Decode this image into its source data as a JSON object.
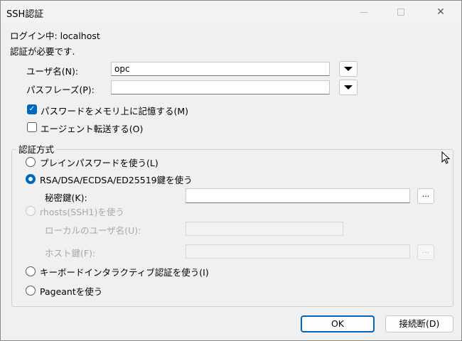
{
  "window": {
    "title": "SSH認証",
    "minimize_icon": "minimize-icon",
    "maximize_icon": "maximize-icon",
    "close_icon": "close-icon",
    "close_glyph": "✕"
  },
  "info": {
    "login_line": "ログイン中: localhost",
    "auth_required": "認証が必要です."
  },
  "form": {
    "username_label": "ユーザ名(N):",
    "username_value": "opc",
    "passphrase_label": "パスフレーズ(P):",
    "passphrase_value": "",
    "remember_password": {
      "label": "パスワードをメモリ上に記憶する(M)",
      "checked": true
    },
    "agent_forward": {
      "label": "エージェント転送する(O)",
      "checked": false
    }
  },
  "auth_method": {
    "group_label": "認証方式",
    "options": [
      {
        "label": "プレインパスワードを使う(L)",
        "selected": false,
        "enabled": true
      },
      {
        "label": "RSA/DSA/ECDSA/ED25519鍵を使う",
        "selected": true,
        "enabled": true
      },
      {
        "label": "rhosts(SSH1)を使う",
        "selected": false,
        "enabled": false
      },
      {
        "label": "キーボードインタラクティブ認証を使う(I)",
        "selected": false,
        "enabled": true
      },
      {
        "label": "Pageantを使う",
        "selected": false,
        "enabled": true
      }
    ],
    "private_key_label": "秘密鍵(K):",
    "private_key_value": "",
    "browse_label": "...",
    "local_user_label": "ローカルのユーザ名(U):",
    "local_user_value": "",
    "host_key_label": "ホスト鍵(F):",
    "host_key_value": ""
  },
  "buttons": {
    "ok": "OK",
    "disconnect": "接続断(D)"
  },
  "icons": {
    "dropdown": "chevron-down-icon",
    "checkmark": "✓",
    "cursor": "mouse-cursor-icon"
  },
  "colors": {
    "accent": "#0067c0",
    "window_bg": "#f0f0f0",
    "disabled_text": "#a8a8a8"
  }
}
